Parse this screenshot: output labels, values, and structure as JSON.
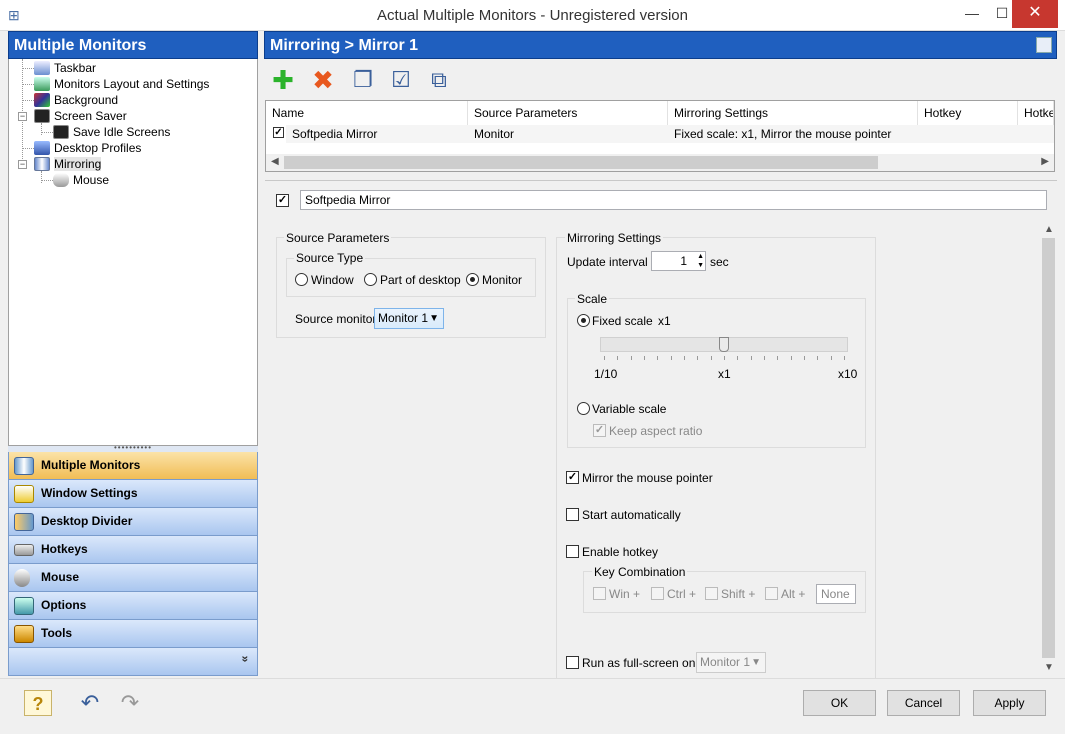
{
  "window": {
    "title": "Actual Multiple Monitors - Unregistered version",
    "minimize": "—",
    "maximize": "☐",
    "close": "✕"
  },
  "left": {
    "header": "Multiple Monitors",
    "tree": [
      {
        "label": "Taskbar"
      },
      {
        "label": "Monitors Layout and Settings"
      },
      {
        "label": "Background"
      },
      {
        "label": "Screen Saver"
      },
      {
        "label": "Save Idle Screens"
      },
      {
        "label": "Desktop Profiles"
      },
      {
        "label": "Mirroring"
      },
      {
        "label": "Mouse"
      }
    ],
    "splitter": "••••••••••",
    "nav": [
      {
        "label": "Multiple Monitors"
      },
      {
        "label": "Window Settings"
      },
      {
        "label": "Desktop Divider"
      },
      {
        "label": "Hotkeys"
      },
      {
        "label": "Mouse"
      },
      {
        "label": "Options"
      },
      {
        "label": "Tools"
      }
    ],
    "more": "»"
  },
  "right": {
    "header": "Mirroring > Mirror 1",
    "toolbar": {
      "add": "✚",
      "delete": "✖",
      "copy": "❐",
      "check": "☑",
      "windows": "⧉"
    },
    "grid": {
      "columns": [
        "Name",
        "Source Parameters",
        "Mirroring Settings",
        "Hotkey",
        "Hotkey"
      ],
      "rows": [
        {
          "name": "Softpedia Mirror",
          "source": "Monitor",
          "settings": "Fixed scale: x1, Mirror the mouse pointer",
          "hotkey": "",
          "hotkey2": ""
        }
      ]
    },
    "detail": {
      "name_value": "Softpedia Mirror",
      "source_params_title": "Source Parameters",
      "source_type_title": "Source Type",
      "window_label": "Window",
      "part_label": "Part of desktop",
      "monitor_label": "Monitor",
      "source_monitor_label": "Source monitor:",
      "source_monitor_value": "Monitor 1",
      "mirroring_settings_title": "Mirroring Settings",
      "update_interval_label": "Update interval",
      "update_interval_value": "1",
      "update_interval_unit": "sec",
      "scale_title": "Scale",
      "fixed_scale_label": "Fixed scale",
      "fixed_scale_value": "x1",
      "slider_min": "1/10",
      "slider_mid": "x1",
      "slider_max": "x10",
      "slider_position": 0.5,
      "variable_scale_label": "Variable scale",
      "keep_aspect_label": "Keep aspect ratio",
      "mirror_pointer_label": "Mirror the mouse pointer",
      "start_auto_label": "Start automatically",
      "enable_hotkey_label": "Enable hotkey",
      "key_combination_title": "Key Combination",
      "win_label": "Win +",
      "ctrl_label": "Ctrl +",
      "shift_label": "Shift +",
      "alt_label": "Alt +",
      "key_value": "None",
      "fullscreen_label": "Run as full-screen on",
      "fullscreen_value": "Monitor 1"
    }
  },
  "bottom": {
    "help_icon": "?",
    "undo_icon": "↶",
    "redo_icon": "↷",
    "ok": "OK",
    "cancel": "Cancel",
    "apply": "Apply"
  },
  "colors": {
    "header_blue": "#1f5fbf",
    "nav_active": "#f1bd55",
    "close_red": "#c7372f"
  }
}
